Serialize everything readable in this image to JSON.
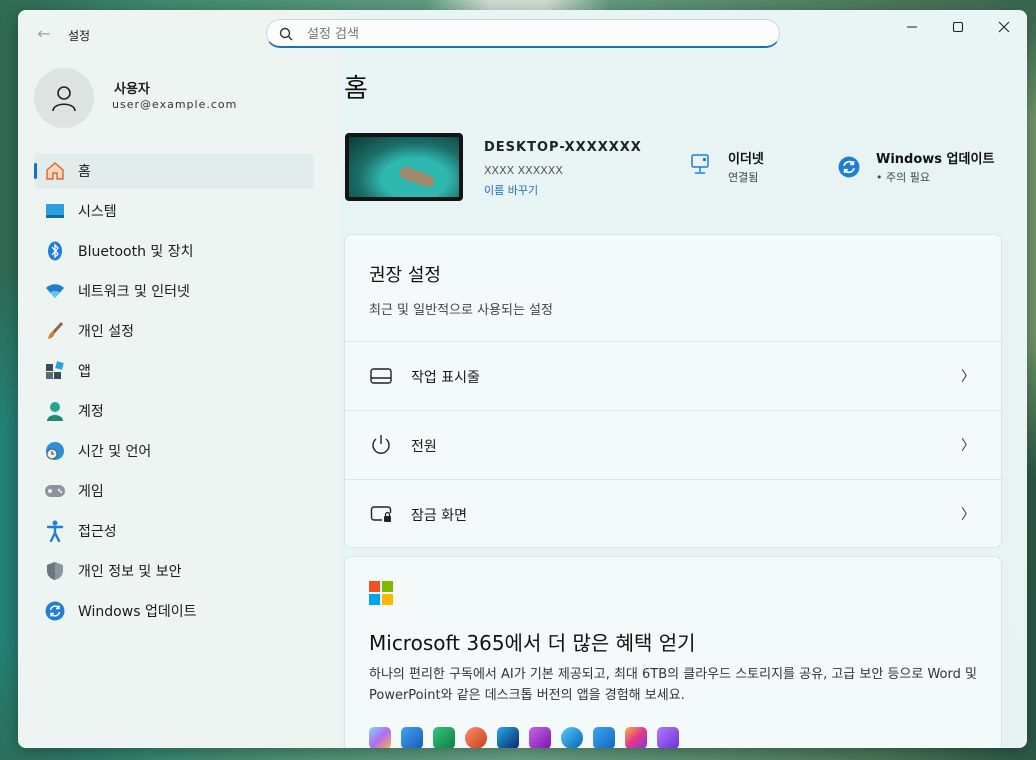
{
  "app": {
    "title": "설정"
  },
  "search": {
    "placeholder": "설정 검색"
  },
  "user": {
    "name": "사용자",
    "email": "user@example.com"
  },
  "nav": {
    "items": [
      {
        "label": "홈",
        "icon": "home-icon"
      },
      {
        "label": "시스템",
        "icon": "system-icon"
      },
      {
        "label": "Bluetooth 및 장치",
        "icon": "bluetooth-icon"
      },
      {
        "label": "네트워크 및 인터넷",
        "icon": "wifi-icon"
      },
      {
        "label": "개인 설정",
        "icon": "brush-icon"
      },
      {
        "label": "앱",
        "icon": "apps-icon"
      },
      {
        "label": "계정",
        "icon": "account-icon"
      },
      {
        "label": "시간 및 언어",
        "icon": "globe-clock-icon"
      },
      {
        "label": "게임",
        "icon": "gamepad-icon"
      },
      {
        "label": "접근성",
        "icon": "accessibility-icon"
      },
      {
        "label": "개인 정보 및 보안",
        "icon": "shield-icon"
      },
      {
        "label": "Windows 업데이트",
        "icon": "update-icon"
      }
    ]
  },
  "main": {
    "title": "홈",
    "device": {
      "name": "DESKTOP-XXXXXXX",
      "model": "XXXX XXXXXX",
      "rename": "이름 바꾸기"
    },
    "status": {
      "network": {
        "title": "이더넷",
        "sub": "연결됨"
      },
      "update": {
        "title": "Windows 업데이트",
        "sub": "• 주의 필요"
      }
    },
    "recommended": {
      "title": "권장 설정",
      "subtitle": "최근 및 일반적으로 사용되는 설정",
      "rows": [
        {
          "label": "작업 표시줄"
        },
        {
          "label": "전원"
        },
        {
          "label": "잠금 화면"
        }
      ]
    },
    "m365": {
      "title": "Microsoft 365에서 더 많은 혜택 얻기",
      "desc": "하나의 편리한 구독에서 AI가 기본 제공되고, 최대 6TB의 클라우드 스토리지를 공유, 고급 보안 등으로 Word 및 PowerPoint와 같은 데스크톱 버전의 앱을 경험해 보세요.",
      "apps": [
        "copilot-icon",
        "word-icon",
        "excel-icon",
        "powerpoint-icon",
        "outlook-icon",
        "onenote-icon",
        "onedrive-icon",
        "defender-icon",
        "designer-icon",
        "clipchamp-icon"
      ]
    }
  },
  "colors": {
    "accent": "#1b6ec2",
    "sidebar": "#edf4f2",
    "card": "#f4faf9"
  }
}
